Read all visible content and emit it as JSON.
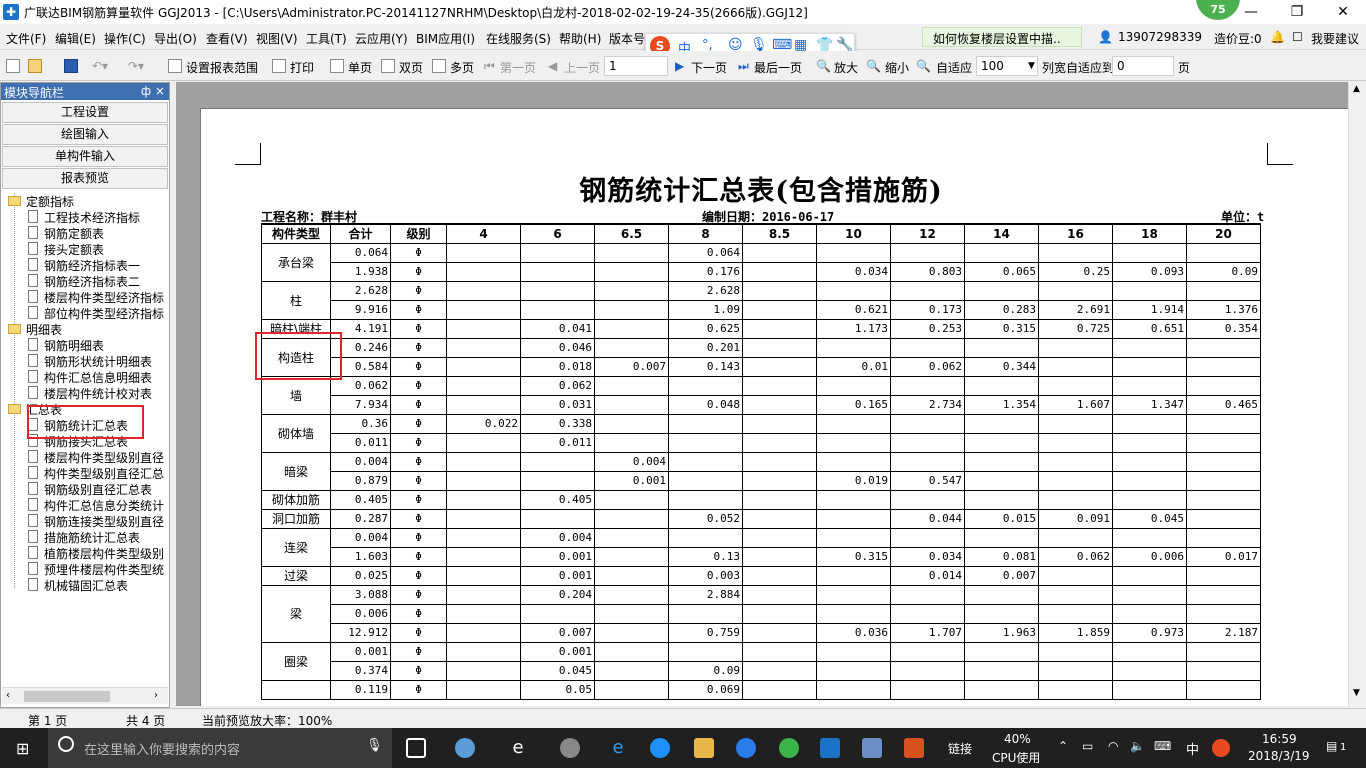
{
  "window": {
    "title": "广联达BIM钢筋算量软件 GGJ2013 - [C:\\Users\\Administrator.PC-20141127NRHM\\Desktop\\白龙村-2018-02-02-19-24-35(2666版).GGJ12]",
    "badge": "75",
    "minimize": "—",
    "maximize": "❐",
    "close": "✕"
  },
  "menu": {
    "items": [
      "文件(F)",
      "编辑(E)",
      "操作(C)",
      "导出(O)",
      "查看(V)",
      "视图(V)",
      "工具(T)",
      "云应用(Y)",
      "BIM应用(I)",
      "在线服务(S)",
      "帮助(H)",
      "版本号(B)"
    ],
    "help_link": "如何恢复楼层设置中描..",
    "phone": "13907298339",
    "score": "造价豆:0",
    "feedback": "我要建议",
    "ime": {
      "lang": "中",
      "punct": "°,"
    }
  },
  "toolbar": {
    "set_range": "设置报表范围",
    "print": "打印",
    "single_page": "单页",
    "double_page": "双页",
    "multi_page": "多页",
    "first_page": "第一页",
    "prev_page": "上一页",
    "page_value": "1",
    "next_page": "下一页",
    "last_page": "最后一页",
    "zoom_in": "放大",
    "zoom_out": "缩小",
    "fit": "自适应",
    "zoom_value": "100",
    "col_fit": "列宽自适应到",
    "col_value": "0",
    "page_unit": "页"
  },
  "nav": {
    "header": "模块导航栏",
    "pin": "ф ×",
    "buttons": [
      "工程设置",
      "绘图输入",
      "单构件输入",
      "报表预览"
    ],
    "tree": [
      {
        "type": "folder",
        "label": "定额指标",
        "level": 0
      },
      {
        "type": "doc",
        "label": "工程技术经济指标",
        "level": 1
      },
      {
        "type": "doc",
        "label": "钢筋定额表",
        "level": 1
      },
      {
        "type": "doc",
        "label": "接头定额表",
        "level": 1
      },
      {
        "type": "doc",
        "label": "钢筋经济指标表一",
        "level": 1
      },
      {
        "type": "doc",
        "label": "钢筋经济指标表二",
        "level": 1
      },
      {
        "type": "doc",
        "label": "楼层构件类型经济指标",
        "level": 1
      },
      {
        "type": "doc",
        "label": "部位构件类型经济指标",
        "level": 1
      },
      {
        "type": "folder",
        "label": "明细表",
        "level": 0
      },
      {
        "type": "doc",
        "label": "钢筋明细表",
        "level": 1
      },
      {
        "type": "doc",
        "label": "钢筋形状统计明细表",
        "level": 1
      },
      {
        "type": "doc",
        "label": "构件汇总信息明细表",
        "level": 1
      },
      {
        "type": "doc",
        "label": "楼层构件统计校对表",
        "level": 1
      },
      {
        "type": "folder",
        "label": "汇总表",
        "level": 0
      },
      {
        "type": "doc",
        "label": "钢筋统计汇总表",
        "level": 1,
        "selected": true
      },
      {
        "type": "doc",
        "label": "钢筋接头汇总表",
        "level": 1
      },
      {
        "type": "doc",
        "label": "楼层构件类型级别直径",
        "level": 1
      },
      {
        "type": "doc",
        "label": "构件类型级别直径汇总",
        "level": 1
      },
      {
        "type": "doc",
        "label": "钢筋级别直径汇总表",
        "level": 1
      },
      {
        "type": "doc",
        "label": "构件汇总信息分类统计",
        "level": 1
      },
      {
        "type": "doc",
        "label": "钢筋连接类型级别直径",
        "level": 1
      },
      {
        "type": "doc",
        "label": "措施筋统计汇总表",
        "level": 1
      },
      {
        "type": "doc",
        "label": "植筋楼层构件类型级别",
        "level": 1
      },
      {
        "type": "doc",
        "label": "预埋件楼层构件类型统",
        "level": 1
      },
      {
        "type": "doc",
        "label": "机械锚固汇总表",
        "level": 1
      }
    ]
  },
  "report": {
    "title": "钢筋统计汇总表(包含措施筋)",
    "project": "工程名称：群丰村",
    "date": "编制日期：2016-06-17",
    "unit": "单位：t",
    "columns": [
      "构件类型",
      "合计",
      "级别",
      "4",
      "6",
      "6.5",
      "8",
      "8.5",
      "10",
      "12",
      "14",
      "16",
      "18",
      "20"
    ],
    "groups": [
      {
        "name": "承台梁",
        "rows": [
          [
            "0.064",
            "Φ",
            "",
            "",
            "",
            "0.064",
            "",
            "",
            "",
            "",
            "",
            "",
            ""
          ],
          [
            "1.938",
            "Φ",
            "",
            "",
            "",
            "0.176",
            "",
            "0.034",
            "0.803",
            "0.065",
            "0.25",
            "0.093",
            "0.09"
          ]
        ]
      },
      {
        "name": "柱",
        "rows": [
          [
            "2.628",
            "Φ",
            "",
            "",
            "",
            "2.628",
            "",
            "",
            "",
            "",
            "",
            "",
            ""
          ],
          [
            "9.916",
            "Φ",
            "",
            "",
            "",
            "1.09",
            "",
            "0.621",
            "0.173",
            "0.283",
            "2.691",
            "1.914",
            "1.376"
          ]
        ]
      },
      {
        "name": "暗柱\\端柱",
        "rows": [
          [
            "4.191",
            "Φ",
            "",
            "0.041",
            "",
            "0.625",
            "",
            "1.173",
            "0.253",
            "0.315",
            "0.725",
            "0.651",
            "0.354"
          ]
        ]
      },
      {
        "name": "构造柱",
        "rows": [
          [
            "0.246",
            "Φ",
            "",
            "0.046",
            "",
            "0.201",
            "",
            "",
            "",
            "",
            "",
            "",
            ""
          ],
          [
            "0.584",
            "Φ",
            "",
            "0.018",
            "0.007",
            "0.143",
            "",
            "0.01",
            "0.062",
            "0.344",
            "",
            "",
            ""
          ]
        ]
      },
      {
        "name": "墙",
        "rows": [
          [
            "0.062",
            "Φ",
            "",
            "0.062",
            "",
            "",
            "",
            "",
            "",
            "",
            "",
            "",
            ""
          ],
          [
            "7.934",
            "Φ",
            "",
            "0.031",
            "",
            "0.048",
            "",
            "0.165",
            "2.734",
            "1.354",
            "1.607",
            "1.347",
            "0.465"
          ]
        ]
      },
      {
        "name": "砌体墙",
        "rows": [
          [
            "0.36",
            "Φ",
            "0.022",
            "0.338",
            "",
            "",
            "",
            "",
            "",
            "",
            "",
            "",
            ""
          ],
          [
            "0.011",
            "Φ",
            "",
            "0.011",
            "",
            "",
            "",
            "",
            "",
            "",
            "",
            "",
            ""
          ]
        ]
      },
      {
        "name": "暗梁",
        "rows": [
          [
            "0.004",
            "Φ",
            "",
            "",
            "0.004",
            "",
            "",
            "",
            "",
            "",
            "",
            "",
            ""
          ],
          [
            "0.879",
            "Φ",
            "",
            "",
            "0.001",
            "",
            "",
            "0.019",
            "0.547",
            "",
            "",
            "",
            ""
          ]
        ]
      },
      {
        "name": "砌体加筋",
        "rows": [
          [
            "0.405",
            "Φ",
            "",
            "0.405",
            "",
            "",
            "",
            "",
            "",
            "",
            "",
            "",
            ""
          ]
        ]
      },
      {
        "name": "洞口加筋",
        "rows": [
          [
            "0.287",
            "Φ",
            "",
            "",
            "",
            "0.052",
            "",
            "",
            "0.044",
            "0.015",
            "0.091",
            "0.045",
            ""
          ]
        ]
      },
      {
        "name": "连梁",
        "rows": [
          [
            "0.004",
            "Φ",
            "",
            "0.004",
            "",
            "",
            "",
            "",
            "",
            "",
            "",
            "",
            ""
          ],
          [
            "1.603",
            "Φ",
            "",
            "0.001",
            "",
            "0.13",
            "",
            "0.315",
            "0.034",
            "0.081",
            "0.062",
            "0.006",
            "0.017"
          ]
        ]
      },
      {
        "name": "过梁",
        "rows": [
          [
            "0.025",
            "Φ",
            "",
            "0.001",
            "",
            "0.003",
            "",
            "",
            "0.014",
            "0.007",
            "",
            "",
            ""
          ]
        ]
      },
      {
        "name": "梁",
        "rows": [
          [
            "3.088",
            "Φ",
            "",
            "0.204",
            "",
            "2.884",
            "",
            "",
            "",
            "",
            "",
            "",
            ""
          ],
          [
            "0.006",
            "Φ",
            "",
            "",
            "",
            "",
            "",
            "",
            "",
            "",
            "",
            "",
            ""
          ],
          [
            "12.912",
            "Φ",
            "",
            "0.007",
            "",
            "0.759",
            "",
            "0.036",
            "1.707",
            "1.963",
            "1.859",
            "0.973",
            "2.187"
          ]
        ]
      },
      {
        "name": "圈梁",
        "rows": [
          [
            "0.001",
            "Φ",
            "",
            "0.001",
            "",
            "",
            "",
            "",
            "",
            "",
            "",
            "",
            ""
          ],
          [
            "0.374",
            "Φ",
            "",
            "0.045",
            "",
            "0.09",
            "",
            "",
            "",
            "",
            "",
            "",
            ""
          ]
        ]
      },
      {
        "name": "",
        "rows": [
          [
            "0.119",
            "Φ",
            "",
            "0.05",
            "",
            "0.069",
            "",
            "",
            "",
            "",
            "",
            "",
            ""
          ]
        ]
      }
    ]
  },
  "status": {
    "page": "第 1 页",
    "total": "共 4 页",
    "zoom": "当前预览放大率：100%"
  },
  "taskbar": {
    "search_placeholder": "在这里输入你要搜索的内容",
    "link": "链接",
    "cpu_pct": "40%",
    "cpu_label": "CPU使用",
    "ime": "中",
    "time": "16:59",
    "date": "2018/3/19",
    "notif": "1"
  }
}
